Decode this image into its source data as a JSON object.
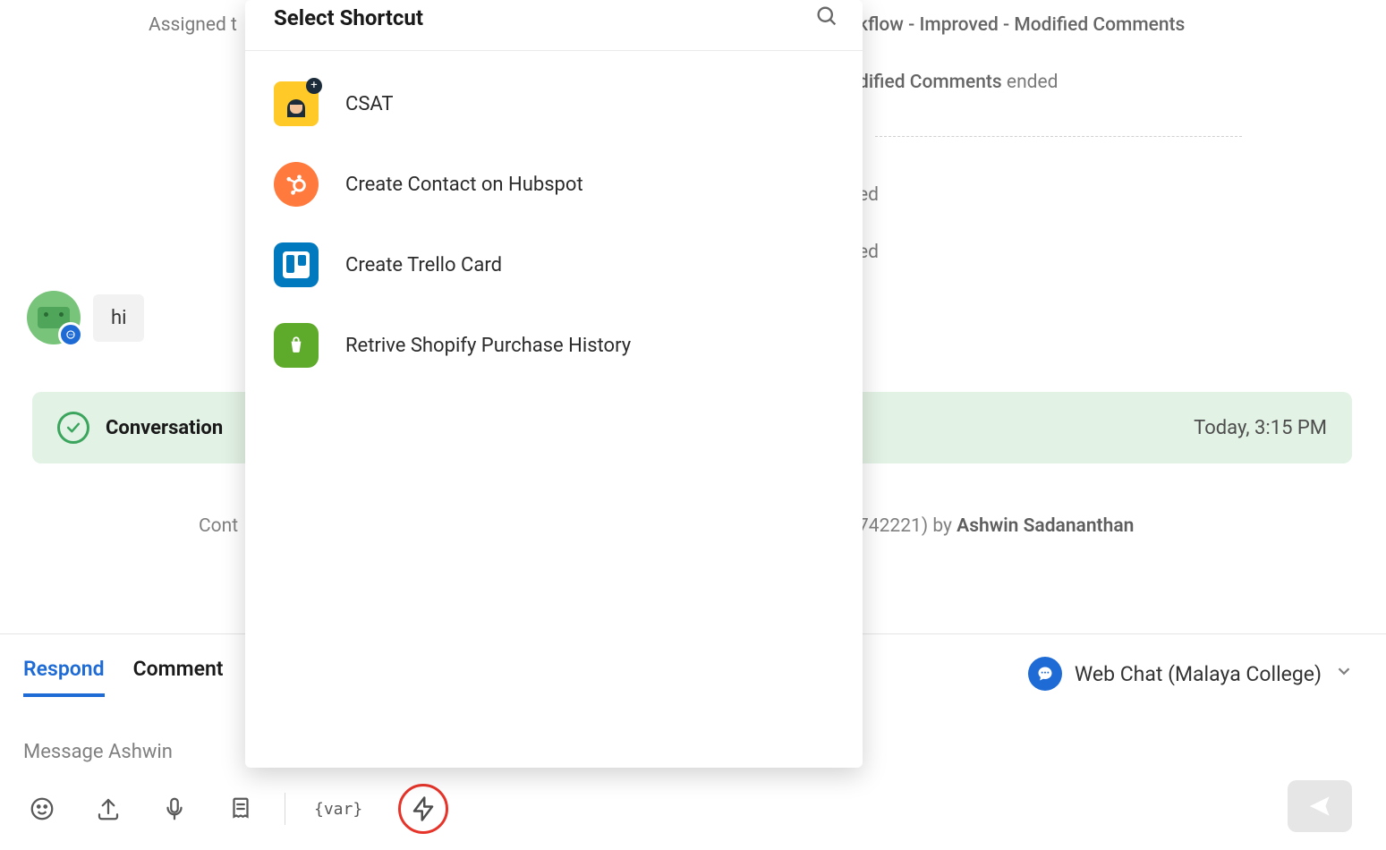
{
  "background": {
    "line1_prefix": "Assigned t",
    "line1_suffix_strong": "kflow - Improved - Modified Comments",
    "line2_strong": "dified Comments",
    "line2_rest": " ended",
    "line3": "ed",
    "line4": "ed"
  },
  "message": {
    "text": "hi"
  },
  "closed": {
    "label": "Conversation",
    "time": "Today, 3:15 PM"
  },
  "moved": {
    "prefix": "Cont",
    "mid": "742221) by ",
    "name": "Ashwin Sadananthan"
  },
  "tabs": {
    "respond": "Respond",
    "comment": "Comment"
  },
  "channel": {
    "label": "Web Chat (Malaya College)"
  },
  "input": {
    "placeholder": "Message Ashwin"
  },
  "toolbar": {
    "var_label": "{var}"
  },
  "popover": {
    "title": "Select Shortcut",
    "items": [
      {
        "label": "CSAT",
        "icon": "csat"
      },
      {
        "label": "Create Contact on Hubspot",
        "icon": "hubspot"
      },
      {
        "label": "Create Trello Card",
        "icon": "trello"
      },
      {
        "label": "Retrive Shopify Purchase History",
        "icon": "shopify"
      }
    ]
  }
}
